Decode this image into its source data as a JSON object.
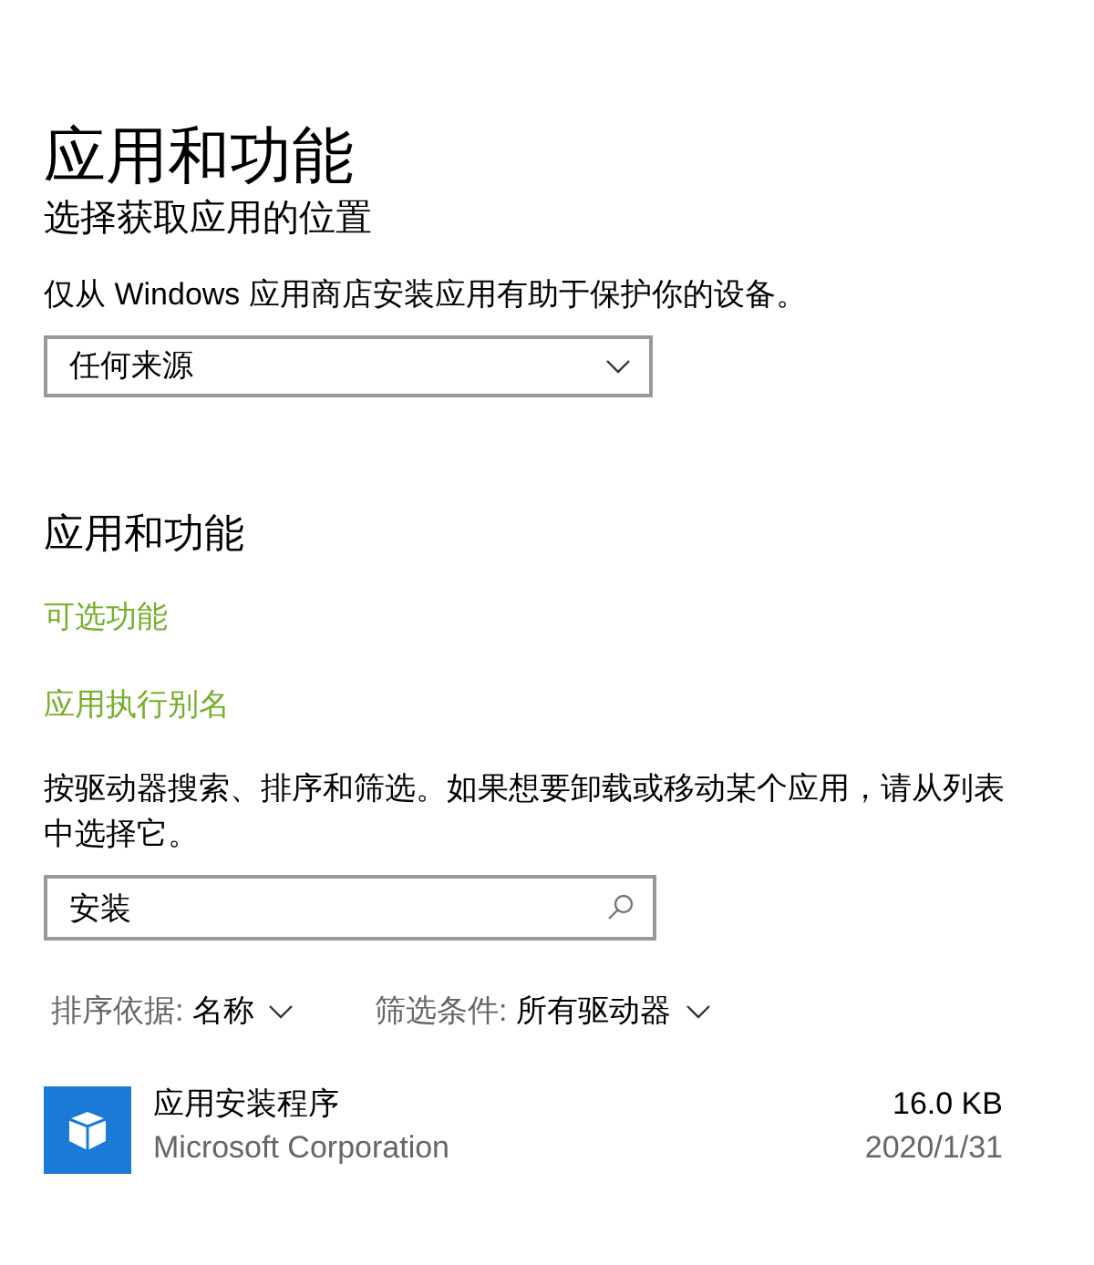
{
  "page_title": "应用和功能",
  "install_source": {
    "heading": "选择获取应用的位置",
    "description": "仅从 Windows 应用商店安装应用有助于保护你的设备。",
    "dropdown": {
      "value": "任何来源"
    }
  },
  "apps_section": {
    "heading": "应用和功能",
    "links": [
      "可选功能",
      "应用执行别名"
    ],
    "description": "按驱动器搜索、排序和筛选。如果想要卸载或移动某个应用，请从列表中选择它。",
    "search": {
      "value": "安装"
    },
    "sort": {
      "label": "排序依据:",
      "value": "名称"
    },
    "filter": {
      "label": "筛选条件:",
      "value": "所有驱动器"
    },
    "apps": [
      {
        "name": "应用安装程序",
        "publisher": "Microsoft Corporation",
        "size": "16.0 KB",
        "date": "2020/1/31"
      }
    ]
  }
}
